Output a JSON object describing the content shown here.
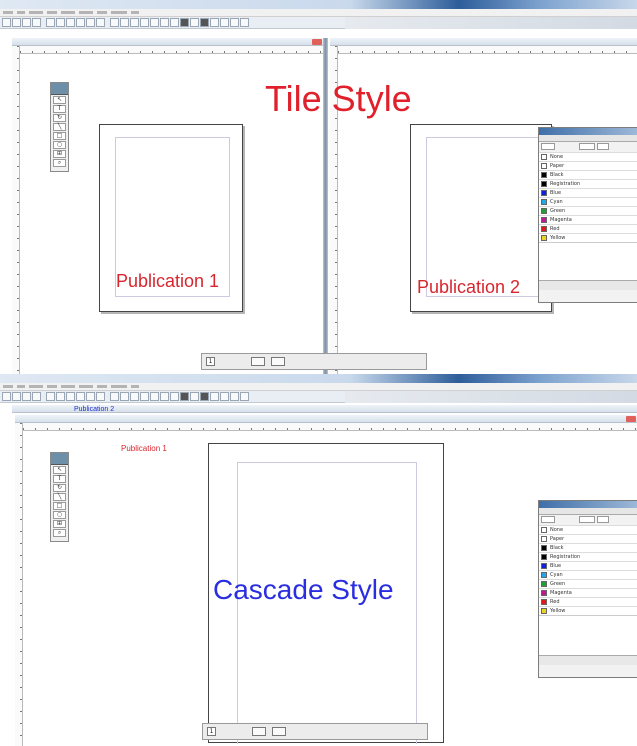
{
  "tile": {
    "caption": "Tile Style",
    "caption_color": "#e0202a",
    "window1": {
      "page_label": "Publication 1"
    },
    "window2": {
      "page_label": "Publication 2"
    },
    "status": {
      "page_number": "1"
    },
    "palette": {
      "rows": [
        {
          "name": "None",
          "color": "#ffffff"
        },
        {
          "name": "Paper",
          "color": "#ffffff"
        },
        {
          "name": "Black",
          "color": "#000000"
        },
        {
          "name": "Registration",
          "color": "#000000"
        },
        {
          "name": "Blue",
          "color": "#1020e0"
        },
        {
          "name": "Cyan",
          "color": "#20a8e8"
        },
        {
          "name": "Green",
          "color": "#20a030"
        },
        {
          "name": "Magenta",
          "color": "#c01890"
        },
        {
          "name": "Red",
          "color": "#e01818"
        },
        {
          "name": "Yellow",
          "color": "#f0d020"
        }
      ]
    }
  },
  "cascade": {
    "caption": "Cascade Style",
    "caption_color": "#2a2ee0",
    "back_tab_label": "Publication 2",
    "front_label": "Publication 1",
    "status": {
      "page_number": "1"
    },
    "palette": {
      "rows": [
        {
          "name": "None",
          "color": "#ffffff"
        },
        {
          "name": "Paper",
          "color": "#ffffff"
        },
        {
          "name": "Black",
          "color": "#000000"
        },
        {
          "name": "Registration",
          "color": "#000000"
        },
        {
          "name": "Blue",
          "color": "#1020e0"
        },
        {
          "name": "Cyan",
          "color": "#20a8e8"
        },
        {
          "name": "Green",
          "color": "#20a030"
        },
        {
          "name": "Magenta",
          "color": "#c01890"
        },
        {
          "name": "Red",
          "color": "#e01818"
        },
        {
          "name": "Yellow",
          "color": "#f0d020"
        }
      ]
    }
  },
  "label_color": "#d8262e"
}
